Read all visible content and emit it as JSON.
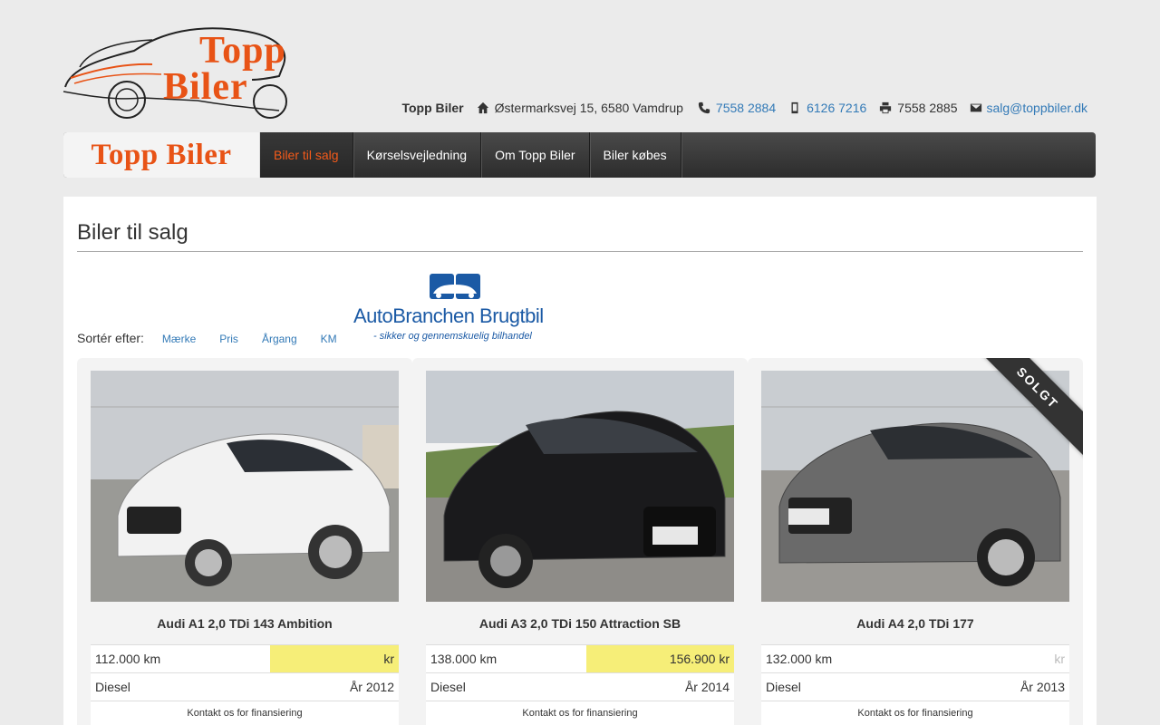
{
  "header": {
    "logo_line1": "Topp",
    "logo_line2": "Biler",
    "company": "Topp Biler",
    "address": "Østermarksvej 15, 6580 Vamdrup",
    "phone": "7558 2884",
    "mobile": "6126 7216",
    "fax": "7558 2885",
    "email": "salg@toppbiler.dk"
  },
  "nav": {
    "brand": "Topp Biler",
    "items": [
      {
        "label": "Biler til salg",
        "active": true
      },
      {
        "label": "Kørselsvejledning",
        "active": false
      },
      {
        "label": "Om Topp Biler",
        "active": false
      },
      {
        "label": "Biler købes",
        "active": false
      }
    ]
  },
  "main": {
    "title": "Biler til salg",
    "sort_label": "Sortér efter:",
    "sort_options": [
      "Mærke",
      "Pris",
      "Årgang",
      "KM"
    ],
    "badge": {
      "name": "AutoBranchen Brugtbil",
      "tagline": "- sikker og gennemskuelig bilhandel"
    }
  },
  "cars": [
    {
      "model": "Audi A1 2,0 TDi 143 Ambition",
      "km": "112.000 km",
      "price": "kr",
      "fuel": "Diesel",
      "year": "År 2012",
      "finance": "Kontakt os for finansiering",
      "sold": false,
      "color": "#f2f2f2"
    },
    {
      "model": "Audi A3 2,0 TDi 150 Attraction SB",
      "km": "138.000 km",
      "price": "156.900 kr",
      "fuel": "Diesel",
      "year": "År 2014",
      "finance": "Kontakt os for finansiering",
      "sold": false,
      "color": "#1a1a1c"
    },
    {
      "model": "Audi A4 2,0 TDi 177",
      "km": "132.000 km",
      "price": "kr",
      "fuel": "Diesel",
      "year": "År 2013",
      "finance": "Kontakt os for finansiering",
      "sold": true,
      "sold_label": "SOLGT",
      "color": "#6a6a6a"
    }
  ],
  "colors": {
    "accent": "#e85316",
    "link": "#337ab7",
    "price_highlight": "#f6ee78",
    "nav_bg": "#3a3a3a"
  },
  "icons": [
    "home-icon",
    "phone-icon",
    "mobile-icon",
    "fax-icon",
    "envelope-icon"
  ]
}
